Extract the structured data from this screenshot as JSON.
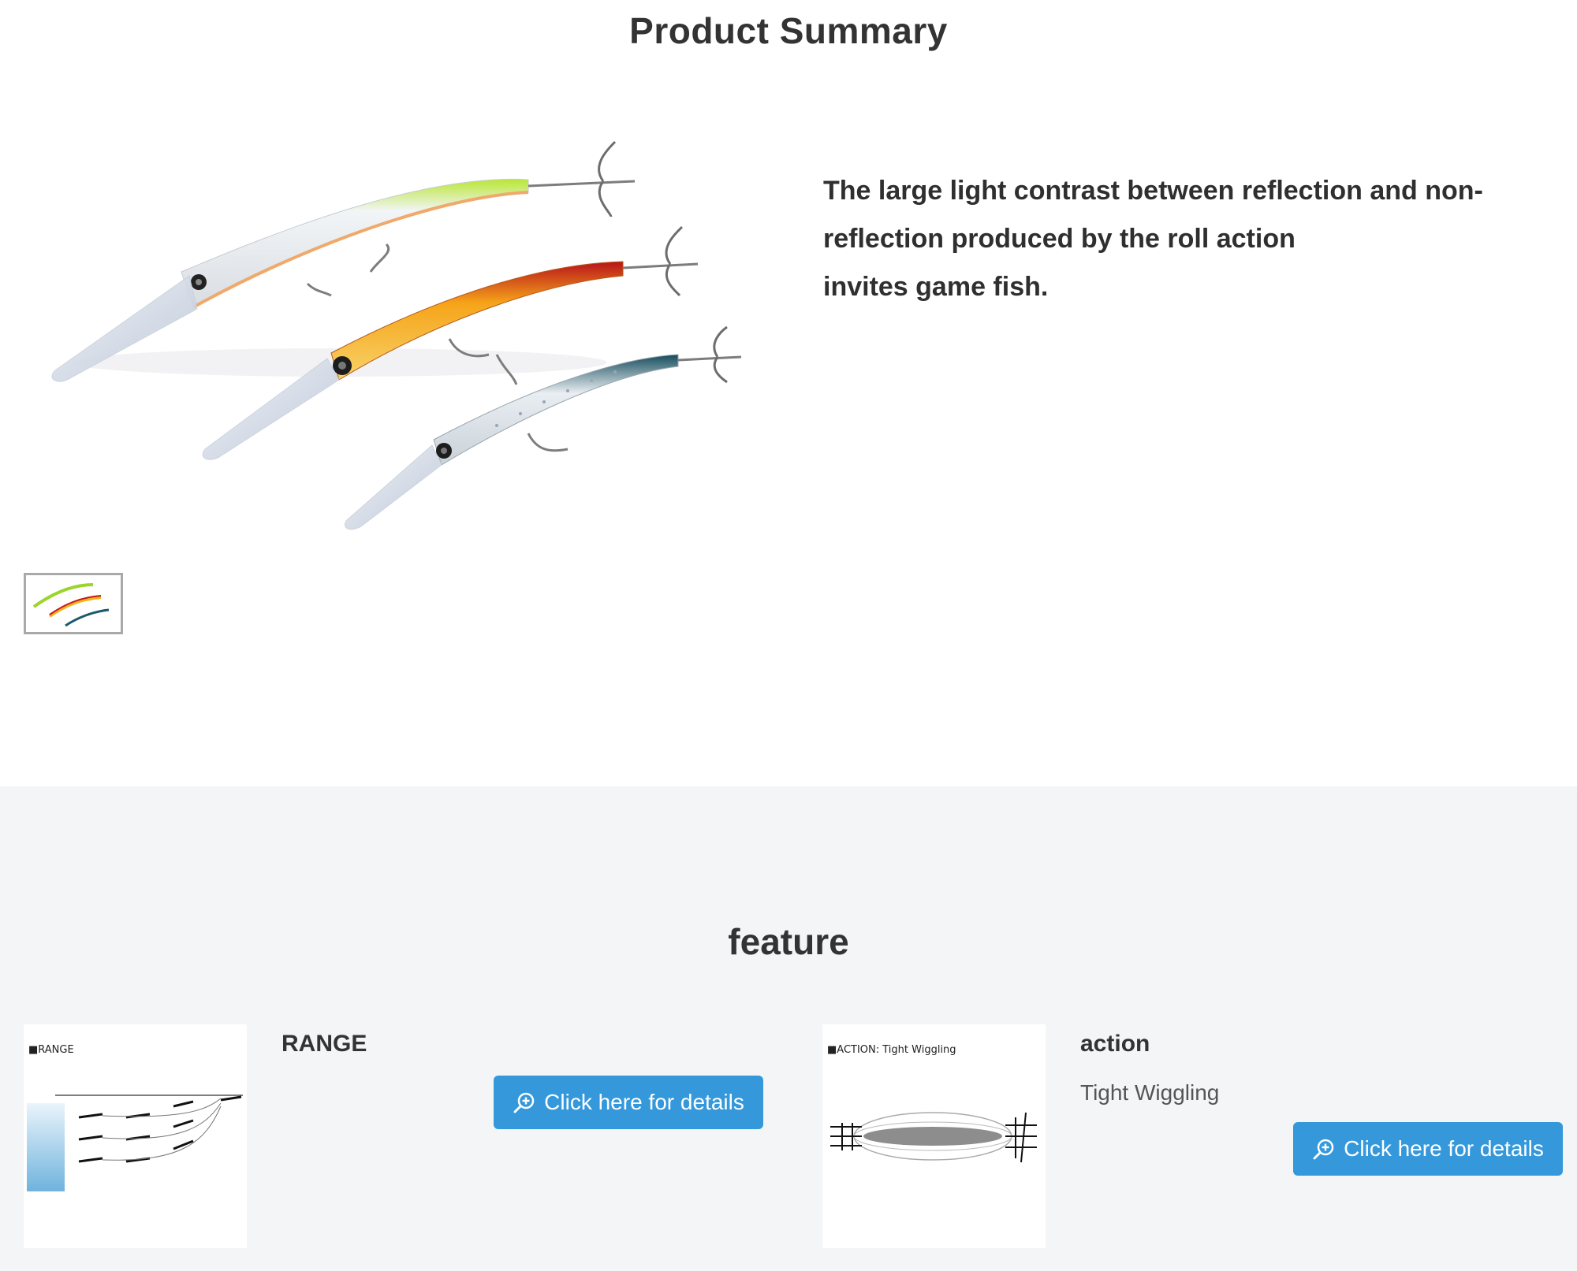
{
  "summary": {
    "title": "Product Summary",
    "description_lines": [
      "The large light contrast between reflection and non-",
      "reflection produced by the roll action",
      "invites game fish."
    ]
  },
  "feature": {
    "title": "feature",
    "cards": [
      {
        "heading": "RANGE",
        "image_caption": "■RANGE",
        "button_label": "Click here for details"
      },
      {
        "heading": "action",
        "subtitle": "Tight Wiggling",
        "image_caption": "■ACTION: Tight Wiggling",
        "button_label": "Click here for details"
      }
    ]
  },
  "colors": {
    "accent": "#3498db",
    "section_bg": "#f4f5f7",
    "lure_green": "#9bd42a",
    "lure_red": "#c8151c",
    "lure_yellow": "#f3b317",
    "lure_teal": "#1b5a6b"
  },
  "icons": [
    "zoom-in-icon"
  ]
}
